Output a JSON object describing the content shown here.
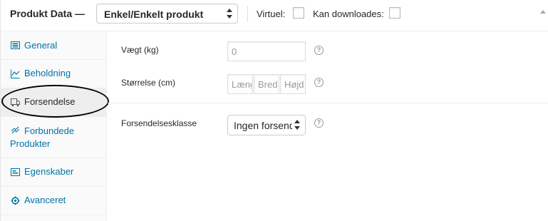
{
  "header": {
    "title": "Produkt Data",
    "dash": "—",
    "product_type": "Enkel/Enkelt produkt",
    "virtual_label": "Virtuel:",
    "downloadable_label": "Kan downloades:"
  },
  "tabs": [
    {
      "label": "General",
      "icon": "grid-icon"
    },
    {
      "label": "Beholdning",
      "icon": "chart-icon"
    },
    {
      "label": "Forsendelse",
      "icon": "truck-icon",
      "active": true
    },
    {
      "label": "Forbundede Produkter",
      "icon": "link-icon"
    },
    {
      "label": "Egenskaber",
      "icon": "list-icon"
    },
    {
      "label": "Avanceret",
      "icon": "gear-icon"
    }
  ],
  "shipping": {
    "weight_label": "Vægt (kg)",
    "weight_placeholder": "0",
    "size_label": "Størrelse (cm)",
    "length_placeholder": "Længde",
    "width_placeholder": "Bredde",
    "height_placeholder": "Højde",
    "class_label": "Forsendelsesklasse",
    "class_value": "Ingen forsendelsesklasse",
    "help_glyph": "?"
  },
  "colors": {
    "link": "#0073aa",
    "active_tab_bg": "#eeeeee"
  }
}
